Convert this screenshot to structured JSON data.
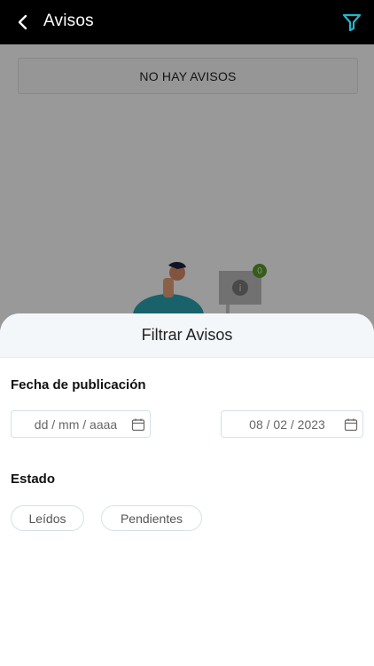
{
  "header": {
    "title": "Avisos"
  },
  "notices": {
    "empty_message": "NO HAY AVISOS",
    "badge_count": "0"
  },
  "filter_sheet": {
    "title": "Filtrar Avisos",
    "date_section_label": "Fecha de publicación",
    "date_from": {
      "value": "",
      "placeholder": "dd / mm / aaaa"
    },
    "date_to": {
      "value": "08 / 02 / 2023"
    },
    "status_section_label": "Estado",
    "status_options": [
      {
        "label": "Leídos"
      },
      {
        "label": "Pendientes"
      }
    ]
  },
  "colors": {
    "topbar": "#000000",
    "accent": "#22b8cf",
    "badge": "#5a9a2a"
  }
}
